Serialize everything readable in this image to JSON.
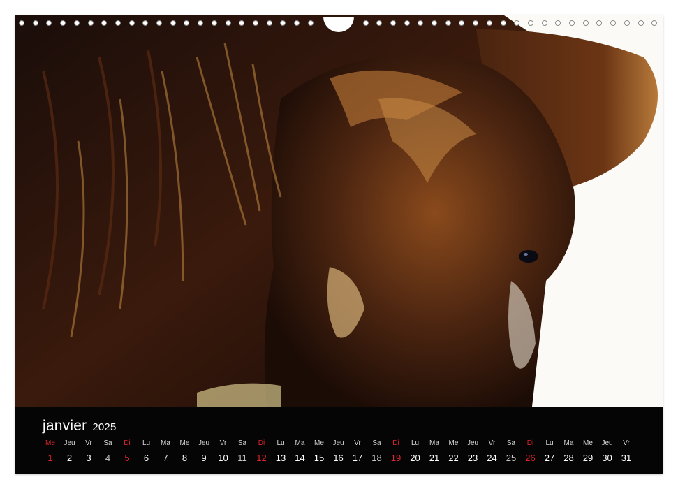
{
  "calendar": {
    "month": "janvier",
    "year": "2025",
    "days": [
      {
        "wd": "Me",
        "d": "1",
        "type": "holiday"
      },
      {
        "wd": "Jeu",
        "d": "2",
        "type": "weekday"
      },
      {
        "wd": "Vr",
        "d": "3",
        "type": "weekday"
      },
      {
        "wd": "Sa",
        "d": "4",
        "type": "saturday"
      },
      {
        "wd": "Di",
        "d": "5",
        "type": "sunday"
      },
      {
        "wd": "Lu",
        "d": "6",
        "type": "weekday"
      },
      {
        "wd": "Ma",
        "d": "7",
        "type": "weekday"
      },
      {
        "wd": "Me",
        "d": "8",
        "type": "weekday"
      },
      {
        "wd": "Jeu",
        "d": "9",
        "type": "weekday"
      },
      {
        "wd": "Vr",
        "d": "10",
        "type": "weekday"
      },
      {
        "wd": "Sa",
        "d": "11",
        "type": "saturday"
      },
      {
        "wd": "Di",
        "d": "12",
        "type": "sunday"
      },
      {
        "wd": "Lu",
        "d": "13",
        "type": "weekday"
      },
      {
        "wd": "Ma",
        "d": "14",
        "type": "weekday"
      },
      {
        "wd": "Me",
        "d": "15",
        "type": "weekday"
      },
      {
        "wd": "Jeu",
        "d": "16",
        "type": "weekday"
      },
      {
        "wd": "Vr",
        "d": "17",
        "type": "weekday"
      },
      {
        "wd": "Sa",
        "d": "18",
        "type": "saturday"
      },
      {
        "wd": "Di",
        "d": "19",
        "type": "sunday"
      },
      {
        "wd": "Lu",
        "d": "20",
        "type": "weekday"
      },
      {
        "wd": "Ma",
        "d": "21",
        "type": "weekday"
      },
      {
        "wd": "Me",
        "d": "22",
        "type": "weekday"
      },
      {
        "wd": "Jeu",
        "d": "23",
        "type": "weekday"
      },
      {
        "wd": "Vr",
        "d": "24",
        "type": "weekday"
      },
      {
        "wd": "Sa",
        "d": "25",
        "type": "saturday"
      },
      {
        "wd": "Di",
        "d": "26",
        "type": "sunday"
      },
      {
        "wd": "Lu",
        "d": "27",
        "type": "weekday"
      },
      {
        "wd": "Ma",
        "d": "28",
        "type": "weekday"
      },
      {
        "wd": "Me",
        "d": "29",
        "type": "weekday"
      },
      {
        "wd": "Jeu",
        "d": "30",
        "type": "weekday"
      },
      {
        "wd": "Vr",
        "d": "31",
        "type": "weekday"
      }
    ]
  },
  "colors": {
    "footer_bg": "#050505",
    "sunday_red": "#e0242c",
    "fur_dark": "#2a1408",
    "fur_mid": "#7a3f18",
    "fur_light": "#d9a25a"
  },
  "photo": {
    "subject_icon": "donkey-portrait"
  }
}
